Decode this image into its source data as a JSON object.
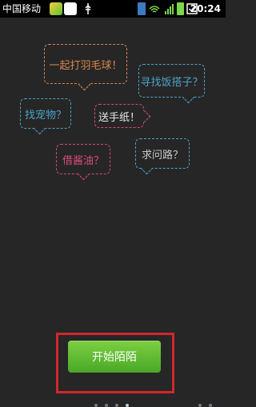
{
  "status_bar": {
    "carrier": "中国移动",
    "time": "20:24"
  },
  "bubbles": [
    {
      "text": "一起打羽毛球！",
      "color": "#d8864f"
    },
    {
      "text": "寻找饭搭子？",
      "color": "#4aa3c9"
    },
    {
      "text": "找宠物？",
      "color": "#4aa3c9"
    },
    {
      "text": "送手纸！",
      "color": "#d94a7a"
    },
    {
      "text": "借酱油？",
      "color": "#d94a7a"
    },
    {
      "text": "求问路？",
      "color": "#4aa3c9"
    }
  ],
  "start_button": {
    "label": "开始陌陌"
  }
}
